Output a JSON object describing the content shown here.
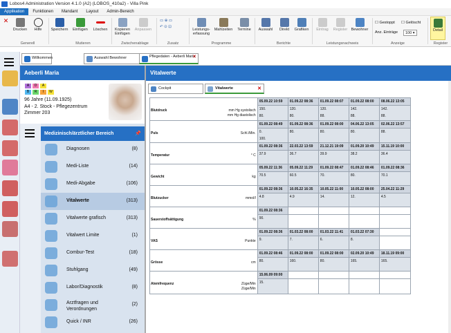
{
  "titlebar": {
    "title": "Lobos4 Administration Version 4.1.0 (A2) (LOBOS_410a2) - Villa Pink"
  },
  "menu": [
    "Applikation",
    "Funktionen",
    "Mandant",
    "Layout",
    "Admin-Bereich"
  ],
  "ribbon": {
    "buttons": [
      "Drucken",
      "Hilfe",
      "Speichern",
      "Einfügen",
      "Löschen",
      "Kopieren Einfügen",
      "Anpassen",
      "Leistungs-erfassung",
      "Mahlzeiten",
      "Termine",
      "Auswahl",
      "Direkt",
      "Grafiken",
      "Eintrag",
      "Register",
      "Bewohner",
      "Detail"
    ],
    "groups": [
      "Generell",
      "Mutieren",
      "Zwischenablage",
      "Zusatz",
      "Programme",
      "Berichte",
      "Leistungsnachweis",
      "Anzeige",
      "Register"
    ],
    "gestoppt": "Gestoppt",
    "geloescht": "Gelöscht",
    "anz_label": "Anz. Einträge",
    "anz_value": "100"
  },
  "doc_tabs": [
    "Willkommen",
    "Auswahl Bewohner",
    "Pflegedaten - Aeberli Maria"
  ],
  "patient": {
    "name": "Aeberli Maria",
    "tags1": [
      "A",
      "D",
      "A"
    ],
    "tags2": [
      "B",
      "R",
      "I",
      "W"
    ],
    "line1": "96 Jahre (11.09.1925)",
    "line2": "A4 - 2. Stock - Pflegezentrum",
    "line3": "Zimmer 203"
  },
  "nav": {
    "title": "Medizinisch/ärztlicher Bereich",
    "items": [
      {
        "label": "Diagnosen",
        "count": "(8)"
      },
      {
        "label": "Medi-Liste",
        "count": "(14)"
      },
      {
        "label": "Medi-Abgabe",
        "count": "(106)"
      },
      {
        "label": "Vitalwerte",
        "count": "(313)"
      },
      {
        "label": "Vitalwerte grafisch",
        "count": "(313)"
      },
      {
        "label": "Vitalwert Limite",
        "count": "(1)"
      },
      {
        "label": "Combur-Test",
        "count": "(18)"
      },
      {
        "label": "Stuhlgang",
        "count": "(49)"
      },
      {
        "label": "Labor/Diagnostik",
        "count": "(8)"
      },
      {
        "label": "Arztfragen und Verordnungen",
        "count": "(2)"
      },
      {
        "label": "Quick / INR",
        "count": "(26)"
      }
    ]
  },
  "vital": {
    "title": "Vitalwerte",
    "tabs": [
      "Cockpit",
      "Vitalwerte"
    ],
    "sections": [
      {
        "label": "Blutdruck",
        "units": [
          "mm Hg systolisch",
          "mm Hg diastolisch"
        ],
        "dates": [
          "05.09.22 10:59",
          "01.09.22 08:36",
          "01.09.22 08:07",
          "01.09.22 08:00",
          "08.06.22 13:05"
        ],
        "values": [
          "150.\n80.",
          "120.\n80.",
          "120.\n88.",
          "142.\n88.",
          "142.\n88."
        ]
      },
      {
        "label": "Puls",
        "units": [
          "Schl./Min."
        ],
        "dates": [
          "01.09.22 08:49",
          "01.09.22 08:36",
          "01.09.22 08:00",
          "04.06.22 13:05",
          "02.06.22 13:57"
        ],
        "values": [
          "0.\n100.",
          "80.",
          "80.",
          "80.",
          "88."
        ]
      },
      {
        "label": "Temperatur",
        "units": [
          "° C"
        ],
        "dates": [
          "01.09.22 08:36",
          "22.03.22 13:59",
          "21.12.21 19:09",
          "01.09.20 10:49",
          "15.11.19 10:00"
        ],
        "values": [
          "37.9",
          "36.7",
          "39.9",
          "38.2",
          "36.4"
        ]
      },
      {
        "label": "Gewicht",
        "units": [
          "kg"
        ],
        "dates": [
          "05.09.22 11:36",
          "05.09.22 11:29",
          "01.09.22 08:47",
          "01.09.22 08:46",
          "01.09.22 08:36"
        ],
        "values": [
          "70.5",
          "60.5",
          "70.",
          "80.",
          "70.1"
        ]
      },
      {
        "label": "Blutzucker",
        "units": [
          "mmol/l"
        ],
        "dates": [
          "01.09.22 08:36",
          "10.05.22 16:35",
          "10.05.22 11:00",
          "10.05.22 08:00",
          "25.04.22 11:29"
        ],
        "values": [
          "4.8",
          "4.9",
          "14.",
          "12.",
          "4.5"
        ]
      },
      {
        "label": "Sauerstoffsättigung",
        "units": [
          "%"
        ],
        "dates": [
          "01.09.22 08:36",
          "",
          "",
          "",
          ""
        ],
        "values": [
          "90.",
          "",
          "",
          "",
          ""
        ]
      },
      {
        "label": "VAS",
        "units": [
          "Punkte"
        ],
        "dates": [
          "01.09.22 08:36",
          "01.03.22 08:00",
          "01.03.22 11:41",
          "01.03.22 07:30",
          ""
        ],
        "values": [
          "9.",
          "7.",
          "6.",
          "8.",
          ""
        ]
      },
      {
        "label": "Grösse",
        "units": [
          "cm"
        ],
        "dates": [
          "01.09.22 08:46",
          "01.09.22 08:00",
          "01.09.22 08:00",
          "02.09.20 10:49",
          "18.11.19 09:00"
        ],
        "values": [
          "80.",
          "160.",
          "80.",
          "165.",
          "165."
        ]
      },
      {
        "label": "Atemfrequenz",
        "units": [
          "Züge/Min",
          "Züge/Min"
        ],
        "dates": [
          "15.06.09 09:00",
          "",
          "",
          "",
          ""
        ],
        "values": [
          "15.",
          "",
          "",
          "",
          ""
        ]
      }
    ]
  },
  "colors": {
    "accent": "#2670c4",
    "menu_active": "#1f6fbf",
    "nav_selected": "#b7cbe3"
  }
}
